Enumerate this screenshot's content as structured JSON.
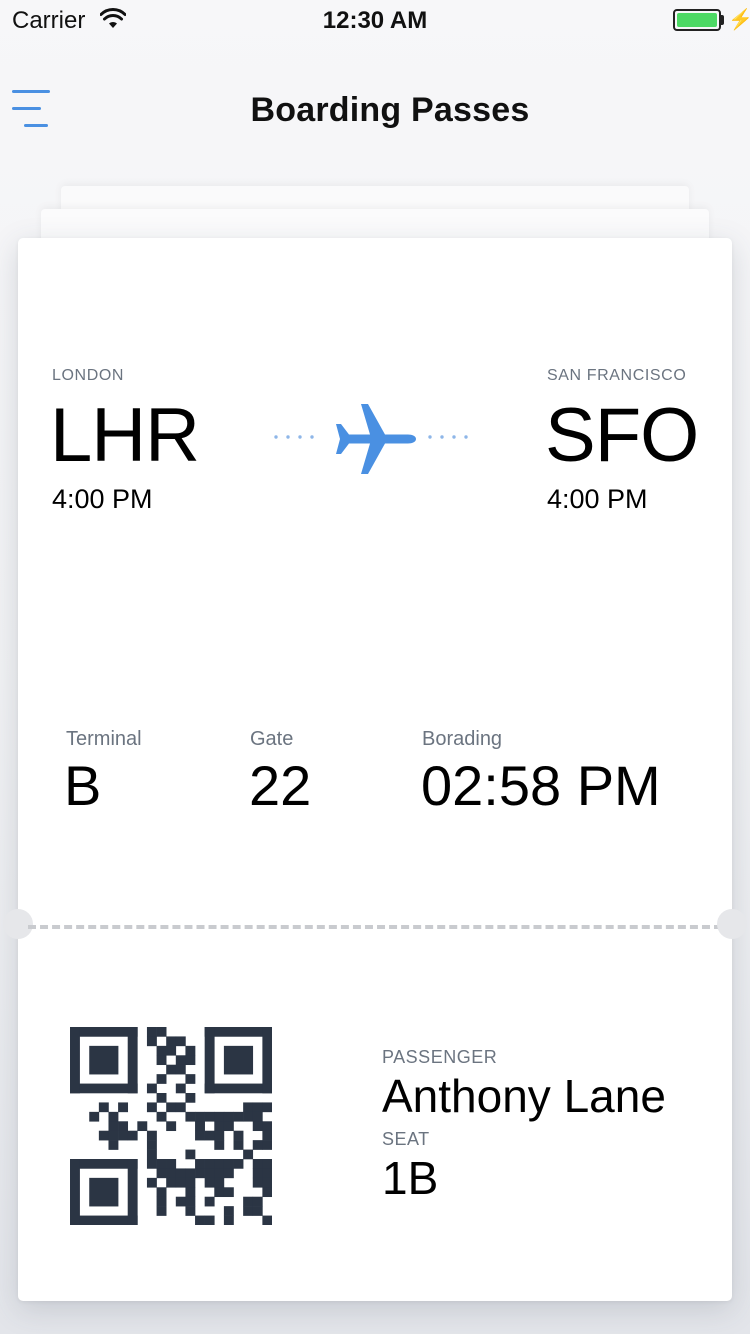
{
  "status_bar": {
    "carrier": "Carrier",
    "time": "12:30 AM",
    "battery_level": 1.0,
    "battery_color": "#4cd964",
    "charging_glyph": "⚡"
  },
  "nav": {
    "title": "Boarding Passes",
    "menu_icon": "hamburger-menu-icon",
    "accent_color": "#4a90e2"
  },
  "flight": {
    "origin": {
      "city": "LONDON",
      "code": "LHR",
      "time": "4:00 PM"
    },
    "destination": {
      "city": "SAN FRANCISCO",
      "code": "SFO",
      "time": "4:00 PM"
    },
    "route_icon": "airplane-icon"
  },
  "details": {
    "terminal_label": "Terminal",
    "terminal_value": "B",
    "gate_label": "Gate",
    "gate_value": "22",
    "boarding_label": "Borading",
    "boarding_value": "02:58 PM"
  },
  "passenger": {
    "passenger_label": "PASSENGER",
    "passenger_name": "Anthony Lane",
    "seat_label": "SEAT",
    "seat_value": "1B",
    "qr_icon": "qr-code-icon"
  }
}
